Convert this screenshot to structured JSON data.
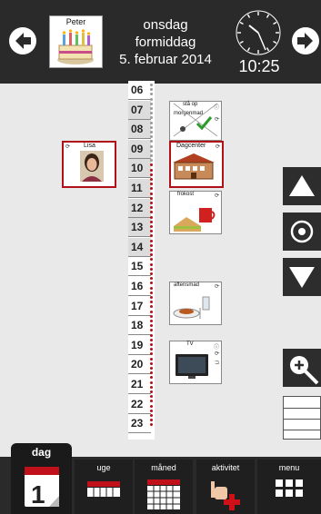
{
  "header": {
    "profile_name": "Peter",
    "weekday": "onsdag",
    "part_of_day": "formiddag",
    "date": "5. februar 2014",
    "time": "10:25"
  },
  "timeline": {
    "hours": [
      "06",
      "07",
      "08",
      "09",
      "10",
      "11",
      "12",
      "13",
      "14",
      "15",
      "16",
      "17",
      "18",
      "19",
      "20",
      "21",
      "22",
      "23"
    ]
  },
  "activities": [
    {
      "id": "sta-op",
      "label": "stå op",
      "sub": "morgenmad"
    },
    {
      "id": "dagcenter",
      "label": "Dagcenter"
    },
    {
      "id": "lisa",
      "label": "Lisa"
    },
    {
      "id": "frokost",
      "label": "frokost"
    },
    {
      "id": "aftensmad",
      "label": "aftensmad"
    },
    {
      "id": "tv",
      "label": "TV"
    }
  ],
  "tabs": {
    "day": "dag",
    "week": "uge",
    "month": "måned",
    "activity": "aktivitet",
    "menu": "menu"
  },
  "colors": {
    "header_bg": "#2a2a2a",
    "background": "#e9e9e9",
    "accent_red": "#c0101a"
  }
}
